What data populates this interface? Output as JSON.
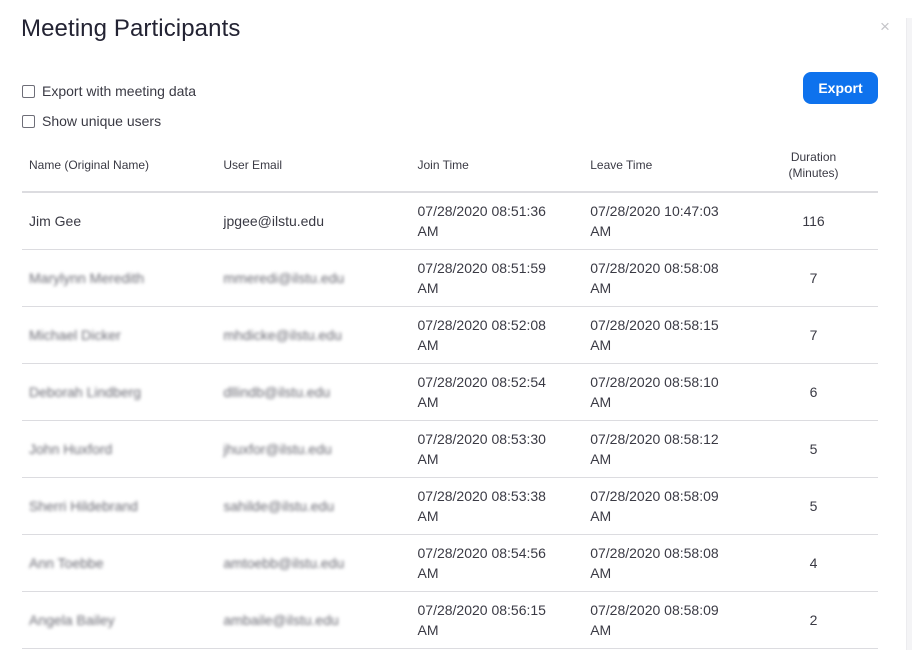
{
  "dialog": {
    "title": "Meeting Participants",
    "close_icon": "×"
  },
  "options": {
    "export_with_meeting_data": {
      "label": "Export with meeting data",
      "checked": false
    },
    "show_unique_users": {
      "label": "Show unique users",
      "checked": false
    }
  },
  "toolbar": {
    "export_label": "Export",
    "accent_color": "#0e72ed"
  },
  "table": {
    "headers": {
      "name": "Name (Original Name)",
      "email": "User Email",
      "join": "Join Time",
      "leave": "Leave Time",
      "duration_line1": "Duration",
      "duration_line2": "(Minutes)"
    },
    "rows": [
      {
        "name": "Jim Gee",
        "email": "jpgee@ilstu.edu",
        "join": "07/28/2020 08:51:36 AM",
        "leave": "07/28/2020 10:47:03 AM",
        "duration": "116",
        "blurred": false
      },
      {
        "name": "Marylynn Meredith",
        "email": "mmeredi@ilstu.edu",
        "join": "07/28/2020 08:51:59 AM",
        "leave": "07/28/2020 08:58:08 AM",
        "duration": "7",
        "blurred": true
      },
      {
        "name": "Michael Dicker",
        "email": "mhdicke@ilstu.edu",
        "join": "07/28/2020 08:52:08 AM",
        "leave": "07/28/2020 08:58:15 AM",
        "duration": "7",
        "blurred": true
      },
      {
        "name": "Deborah Lindberg",
        "email": "dllindb@ilstu.edu",
        "join": "07/28/2020 08:52:54 AM",
        "leave": "07/28/2020 08:58:10 AM",
        "duration": "6",
        "blurred": true
      },
      {
        "name": "John Huxford",
        "email": "jhuxfor@ilstu.edu",
        "join": "07/28/2020 08:53:30 AM",
        "leave": "07/28/2020 08:58:12 AM",
        "duration": "5",
        "blurred": true
      },
      {
        "name": "Sherri Hildebrand",
        "email": "sahilde@ilstu.edu",
        "join": "07/28/2020 08:53:38 AM",
        "leave": "07/28/2020 08:58:09 AM",
        "duration": "5",
        "blurred": true
      },
      {
        "name": "Ann Toebbe",
        "email": "amtoebb@ilstu.edu",
        "join": "07/28/2020 08:54:56 AM",
        "leave": "07/28/2020 08:58:08 AM",
        "duration": "4",
        "blurred": true
      },
      {
        "name": "Angela Bailey",
        "email": "ambaile@ilstu.edu",
        "join": "07/28/2020 08:56:15 AM",
        "leave": "07/28/2020 08:58:09 AM",
        "duration": "2",
        "blurred": true
      }
    ]
  }
}
